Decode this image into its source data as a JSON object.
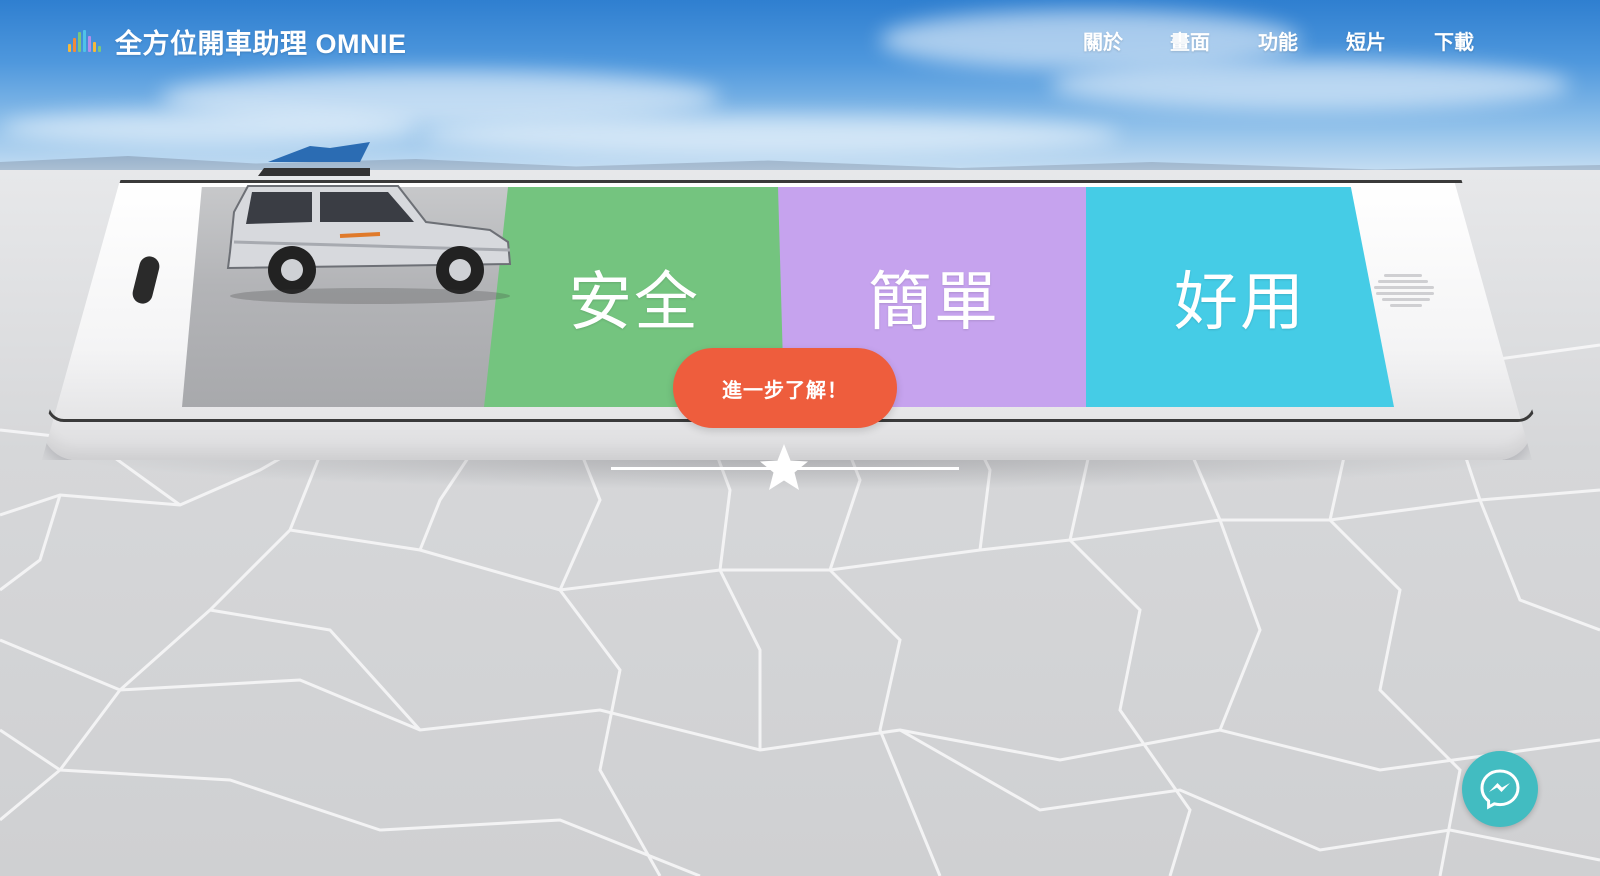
{
  "navbar": {
    "brand": "全方位開車助理 OMNIE",
    "links": [
      "關於",
      "畫面",
      "功能",
      "短片",
      "下載"
    ]
  },
  "hero": {
    "panels": [
      {
        "label": "安全",
        "color": "#74c47f"
      },
      {
        "label": "簡單",
        "color": "#c6a3ee"
      },
      {
        "label": "好用",
        "color": "#45cce6"
      }
    ],
    "cta_label": "進一步了解！"
  },
  "colors": {
    "accent": "#ee5d3d",
    "messenger": "#42bcc1"
  },
  "icons": [
    "logo-bars-icon",
    "star-icon",
    "messenger-icon"
  ]
}
